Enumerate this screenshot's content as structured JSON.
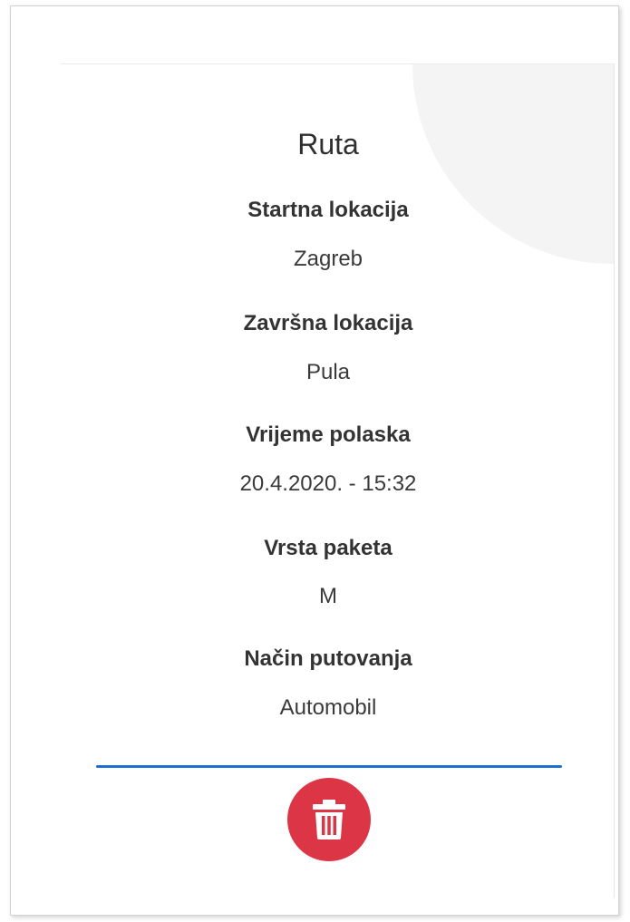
{
  "route": {
    "title": "Ruta",
    "fields": [
      {
        "label": "Startna lokacija",
        "value": "Zagreb"
      },
      {
        "label": "Završna lokacija",
        "value": "Pula"
      },
      {
        "label": "Vrijeme polaska",
        "value": "20.4.2020. - 15:32"
      },
      {
        "label": "Vrsta paketa",
        "value": "M"
      },
      {
        "label": "Način putovanja",
        "value": "Automobil"
      }
    ]
  },
  "actions": {
    "delete_icon": "trash-icon"
  },
  "colors": {
    "accent": "#1f6fce",
    "danger": "#dc3545"
  }
}
